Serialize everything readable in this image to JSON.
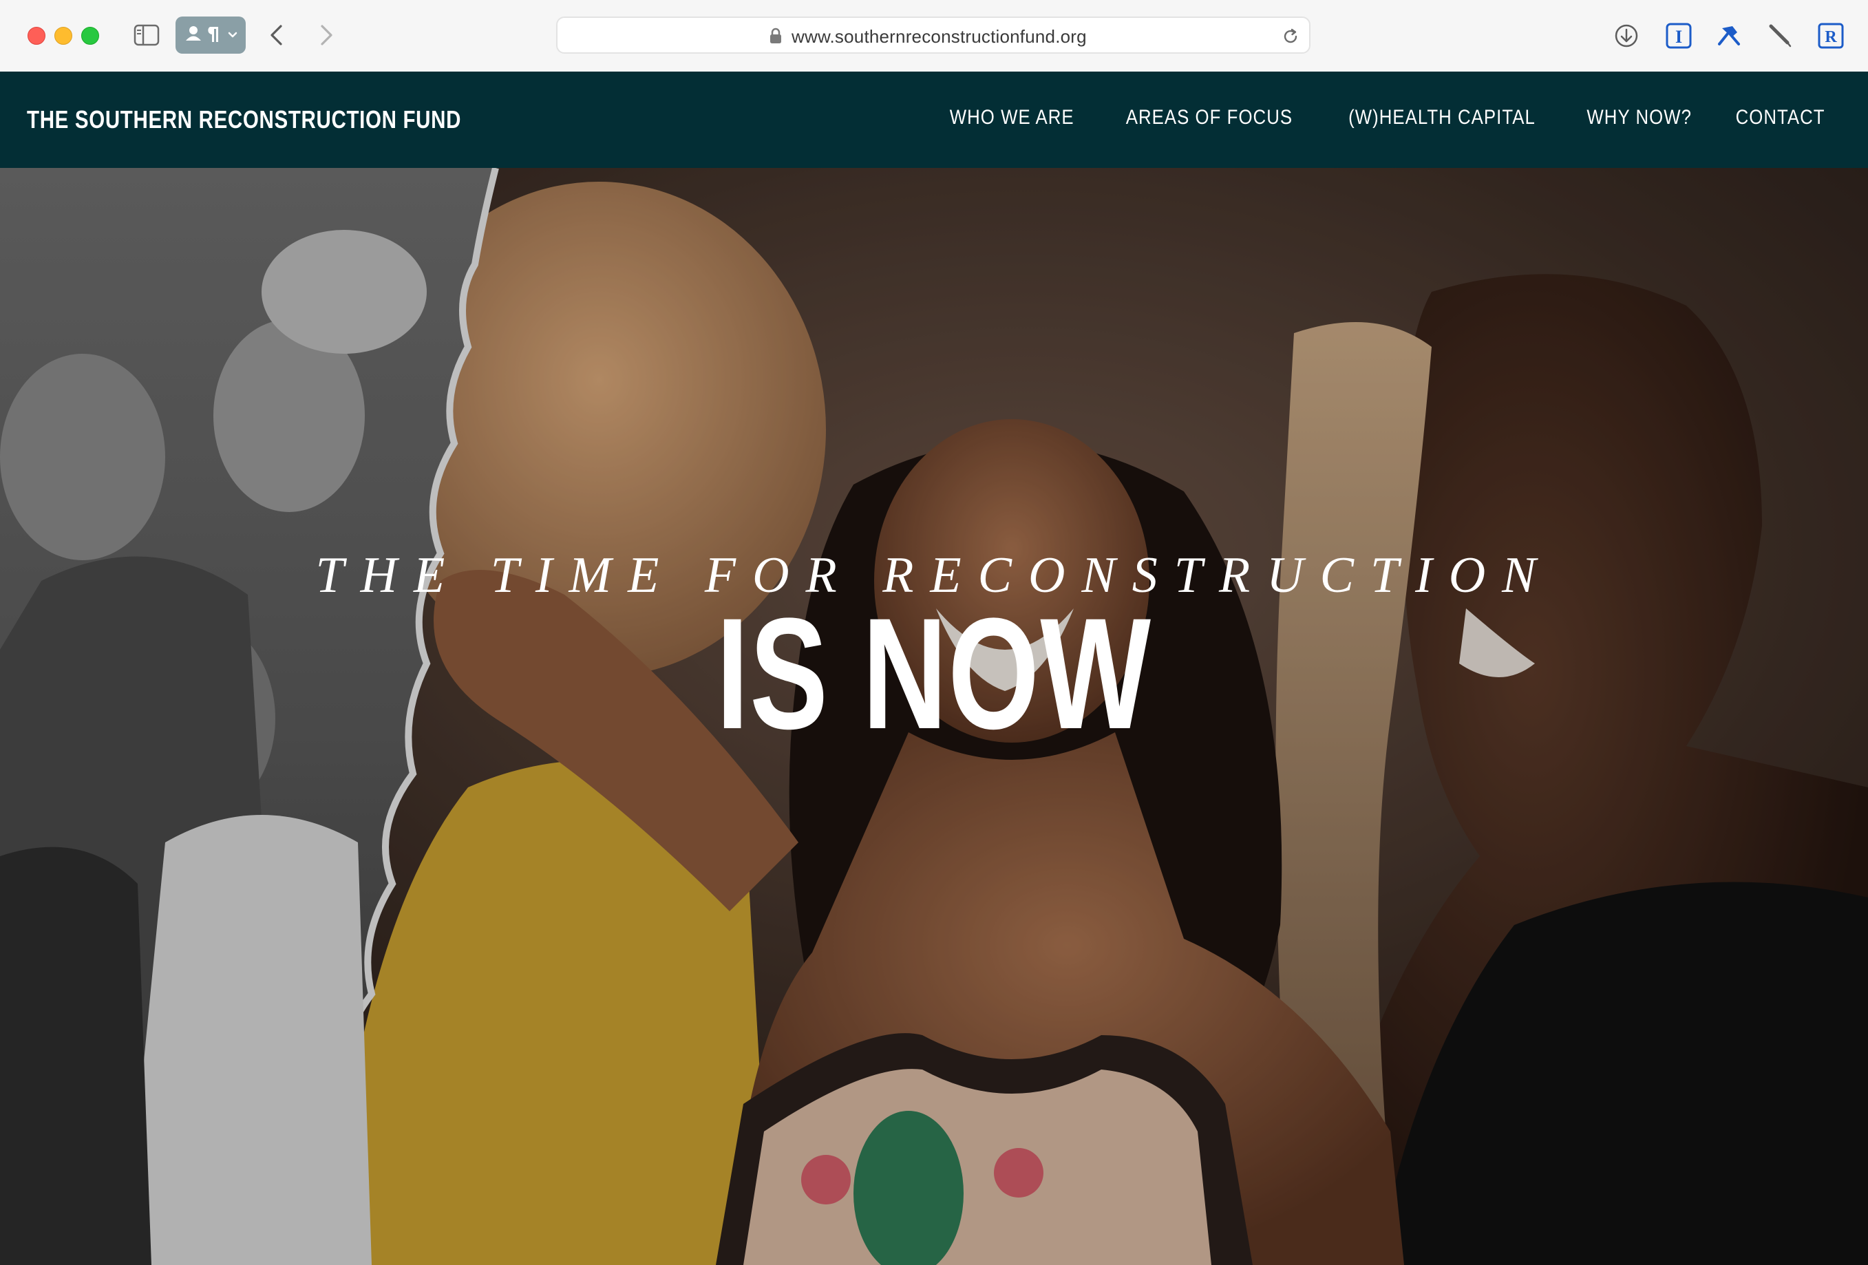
{
  "browser": {
    "url": "www.southernreconstructionfund.org",
    "icons": {
      "sidebar": "sidebar-icon",
      "profile": "profile-icon",
      "back": "chevron-left-icon",
      "forward": "chevron-right-icon",
      "lock": "lock-icon",
      "reload": "reload-icon",
      "download": "download-icon",
      "instapaper": "instapaper-icon",
      "pin": "pin-icon",
      "pen": "pen-icon",
      "readwise": "readwise-icon"
    },
    "toolbar_labels": {
      "instapaper": "I",
      "readwise": "R"
    }
  },
  "site": {
    "logo": "THE SOUTHERN RECONSTRUCTION FUND",
    "nav": [
      {
        "label": "WHO WE ARE"
      },
      {
        "label": "AREAS OF FOCUS"
      },
      {
        "label": "(W)HEALTH CAPITAL"
      },
      {
        "label": "WHY NOW?"
      },
      {
        "label": "CONTACT"
      }
    ],
    "header_color": "#032e35"
  },
  "hero": {
    "kicker": "THE TIME FOR RECONSTRUCTION",
    "headline": "IS NOW"
  }
}
